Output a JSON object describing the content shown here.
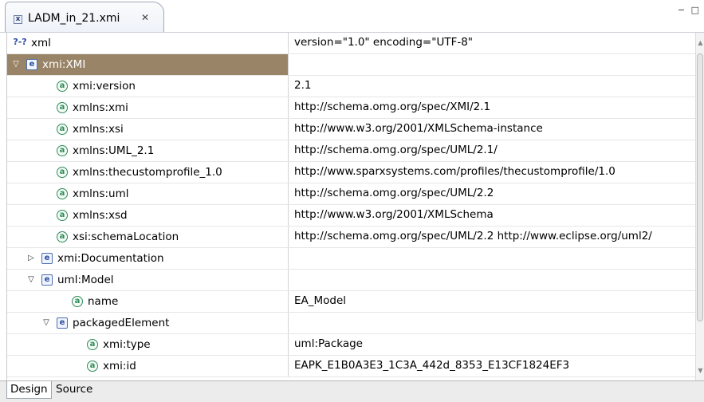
{
  "editor_tab": {
    "icon": "x",
    "title": "LADM_in_21.xmi",
    "close_glyph": "✕"
  },
  "window_controls": "− □",
  "tree": {
    "rows": [
      {
        "indent": 0,
        "twisty": "",
        "kind": "pi",
        "icon_text": "?-?",
        "name": "xml",
        "value": "version=\"1.0\" encoding=\"UTF-8\"",
        "selected": false
      },
      {
        "indent": 0,
        "twisty": "▽",
        "kind": "elem",
        "icon_text": "e",
        "name": "xmi:XMI",
        "value": "",
        "selected": true
      },
      {
        "indent": 2,
        "twisty": "",
        "kind": "attr",
        "icon_text": "a",
        "name": "xmi:version",
        "value": "2.1",
        "selected": false
      },
      {
        "indent": 2,
        "twisty": "",
        "kind": "attr",
        "icon_text": "a",
        "name": "xmlns:xmi",
        "value": "http://schema.omg.org/spec/XMI/2.1",
        "selected": false
      },
      {
        "indent": 2,
        "twisty": "",
        "kind": "attr",
        "icon_text": "a",
        "name": "xmlns:xsi",
        "value": "http://www.w3.org/2001/XMLSchema-instance",
        "selected": false
      },
      {
        "indent": 2,
        "twisty": "",
        "kind": "attr",
        "icon_text": "a",
        "name": "xmlns:UML_2.1",
        "value": "http://schema.omg.org/spec/UML/2.1/",
        "selected": false
      },
      {
        "indent": 2,
        "twisty": "",
        "kind": "attr",
        "icon_text": "a",
        "name": "xmlns:thecustomprofile_1.0",
        "value": "http://www.sparxsystems.com/profiles/thecustomprofile/1.0",
        "selected": false
      },
      {
        "indent": 2,
        "twisty": "",
        "kind": "attr",
        "icon_text": "a",
        "name": "xmlns:uml",
        "value": "http://schema.omg.org/spec/UML/2.2",
        "selected": false
      },
      {
        "indent": 2,
        "twisty": "",
        "kind": "attr",
        "icon_text": "a",
        "name": "xmlns:xsd",
        "value": "http://www.w3.org/2001/XMLSchema",
        "selected": false
      },
      {
        "indent": 2,
        "twisty": "",
        "kind": "attr",
        "icon_text": "a",
        "name": "xsi:schemaLocation",
        "value": "http://schema.omg.org/spec/UML/2.2 http://www.eclipse.org/uml2/",
        "selected": false
      },
      {
        "indent": 1,
        "twisty": "▷",
        "kind": "elem",
        "icon_text": "e",
        "name": "xmi:Documentation",
        "value": "",
        "selected": false
      },
      {
        "indent": 1,
        "twisty": "▽",
        "kind": "elem",
        "icon_text": "e",
        "name": "uml:Model",
        "value": "",
        "selected": false
      },
      {
        "indent": 3,
        "twisty": "",
        "kind": "attr",
        "icon_text": "a",
        "name": "name",
        "value": "EA_Model",
        "selected": false
      },
      {
        "indent": 2,
        "twisty": "▽",
        "kind": "elem",
        "icon_text": "e",
        "name": "packagedElement",
        "value": "",
        "selected": false
      },
      {
        "indent": 4,
        "twisty": "",
        "kind": "attr",
        "icon_text": "a",
        "name": "xmi:type",
        "value": "uml:Package",
        "selected": false
      },
      {
        "indent": 4,
        "twisty": "",
        "kind": "attr",
        "icon_text": "a",
        "name": "xmi:id",
        "value": "EAPK_E1B0A3E3_1C3A_442d_8353_E13CF1824EF3",
        "selected": false
      }
    ]
  },
  "bottom_tabs": [
    {
      "label": "Design",
      "active": true
    },
    {
      "label": "Source",
      "active": false
    }
  ]
}
